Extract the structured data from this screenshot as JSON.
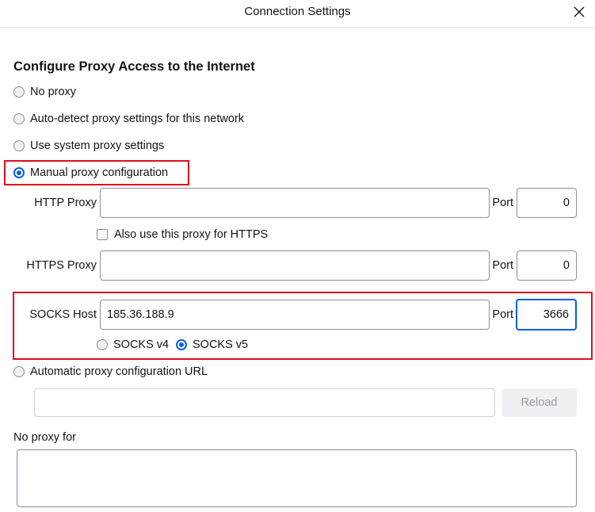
{
  "dialog": {
    "title": "Connection Settings",
    "close_icon": "close-icon"
  },
  "section": {
    "heading": "Configure Proxy Access to the Internet"
  },
  "options": {
    "no_proxy": "No proxy",
    "auto_detect": "Auto-detect proxy settings for this network",
    "system_proxy": "Use system proxy settings",
    "manual": "Manual proxy configuration",
    "auto_config_url": "Automatic proxy configuration URL",
    "selected": "manual"
  },
  "http": {
    "label": "HTTP Proxy",
    "value": "",
    "port_label": "Port",
    "port": "0",
    "also_https": "Also use this proxy for HTTPS",
    "also_https_checked": false
  },
  "https": {
    "label": "HTTPS Proxy",
    "value": "",
    "port_label": "Port",
    "port": "0"
  },
  "socks": {
    "label": "SOCKS Host",
    "value": "185.36.188.9",
    "port_label": "Port",
    "port": "3666",
    "v4": "SOCKS v4",
    "v5": "SOCKS v5",
    "version_selected": "v5"
  },
  "autoconfig": {
    "url": "",
    "reload": "Reload"
  },
  "no_proxy_for": {
    "label": "No proxy for",
    "value": ""
  },
  "colors": {
    "accent": "#0061e0",
    "highlight": "#e20d1a"
  }
}
